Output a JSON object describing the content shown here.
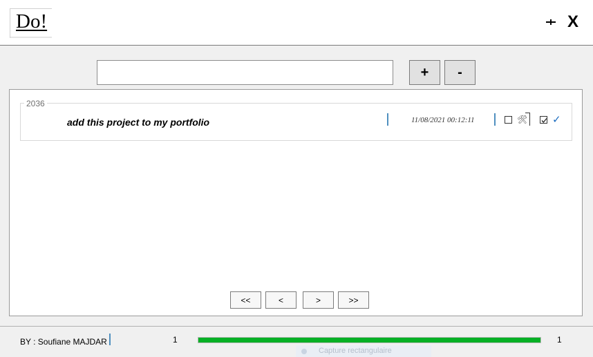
{
  "header": {
    "logo_text": "Do!",
    "minimize_icon": "minimize-icon",
    "close_label": "X"
  },
  "search": {
    "value": "",
    "placeholder": ""
  },
  "toolbar": {
    "add_label": "+",
    "remove_label": "-"
  },
  "tasks": [
    {
      "id": "2036",
      "text": "add this project to my portfolio",
      "date": "11/08/2021 00:12:11",
      "in_progress_checked": false,
      "in_progress_icon": "tools-icon",
      "done_checked": true,
      "done_icon": "check-icon"
    }
  ],
  "pagination": {
    "first": "<<",
    "prev": "<",
    "next": ">",
    "last": ">>"
  },
  "footer": {
    "author": "BY : Soufiane MAJDAR",
    "count_left": "1",
    "count_right": "1",
    "progress_fraction": 1.0,
    "progress_color": "#06b025",
    "ghost_text": "Capture rectangulaire"
  }
}
